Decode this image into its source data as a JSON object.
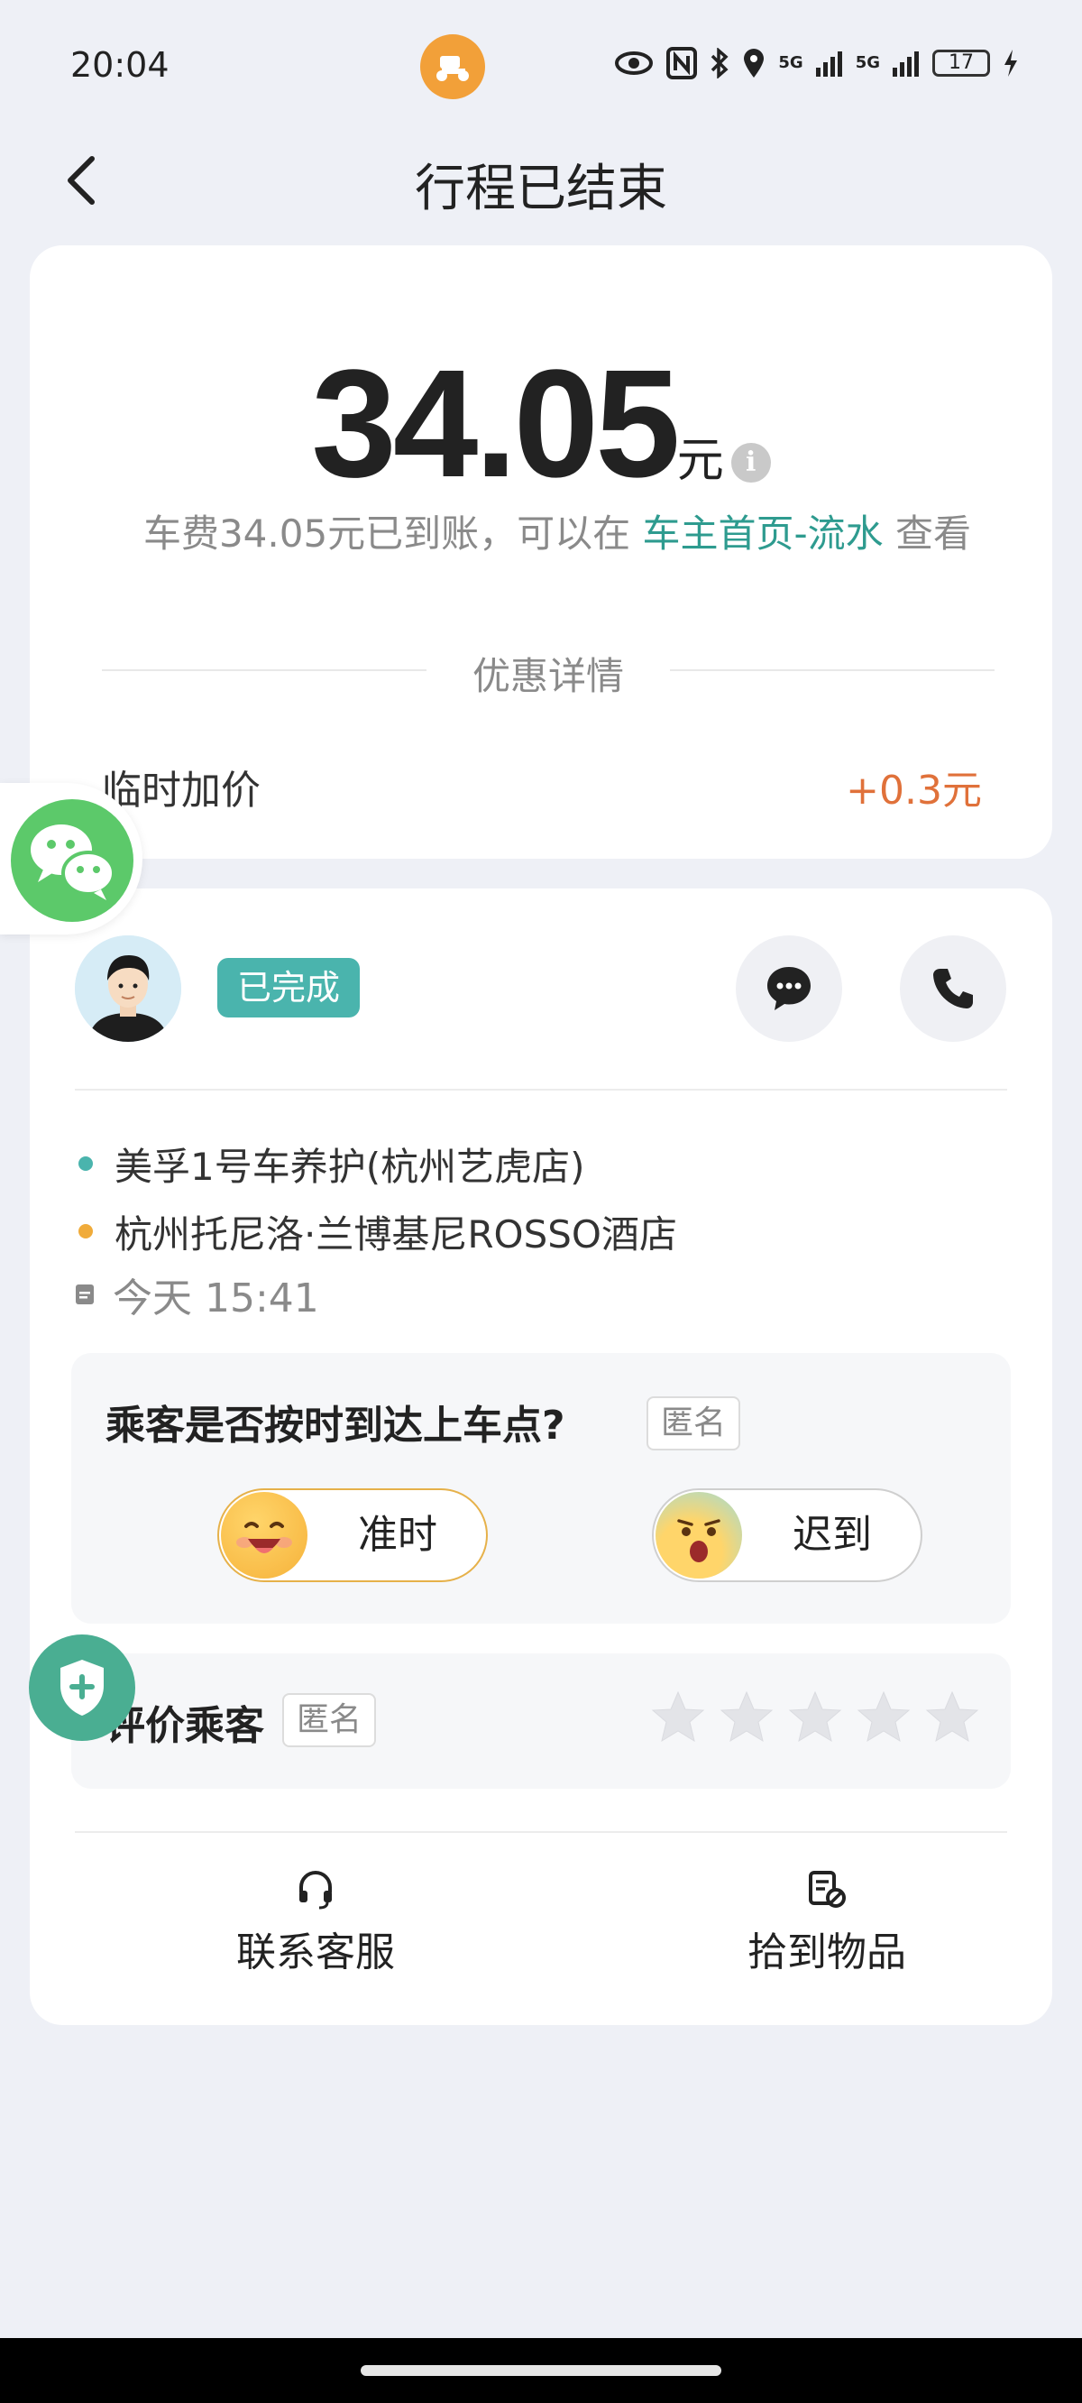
{
  "status_bar": {
    "time": "20:04",
    "battery": "17",
    "network_1": "5G",
    "network_2": "5G",
    "icons": [
      "eye-icon",
      "nfc-icon",
      "bluetooth-icon",
      "location-icon",
      "signal-icon",
      "signal-icon",
      "battery-icon",
      "charging-icon"
    ]
  },
  "nav": {
    "title": "行程已结束"
  },
  "fare": {
    "amount": "34.05",
    "unit": "元",
    "note_prefix": "车费34.05元已到账，可以在 ",
    "note_link": "车主首页-流水",
    "note_suffix": " 查看",
    "discount_header": "优惠详情",
    "surcharge_label": "临时加价",
    "surcharge_value": "+0.3元"
  },
  "trip": {
    "status": "已完成",
    "pickup": "美孚1号车养护(杭州艺虎店)",
    "dropoff": "杭州托尼洛·兰博基尼ROSSO酒店",
    "time": "今天 15:41"
  },
  "punctuality": {
    "question": "乘客是否按时到达上车点?",
    "anonymous": "匿名",
    "on_time": "准时",
    "late": "迟到"
  },
  "rating": {
    "title": "评价乘客",
    "anonymous": "匿名",
    "stars_total": 5,
    "stars_selected": 0
  },
  "footer": {
    "service": "联系客服",
    "lost_items": "拾到物品"
  },
  "colors": {
    "accent_teal": "#2e9b8f",
    "badge_teal": "#4ab4ad",
    "surcharge_orange": "#e0713a",
    "wechat_green": "#5cc96a"
  }
}
